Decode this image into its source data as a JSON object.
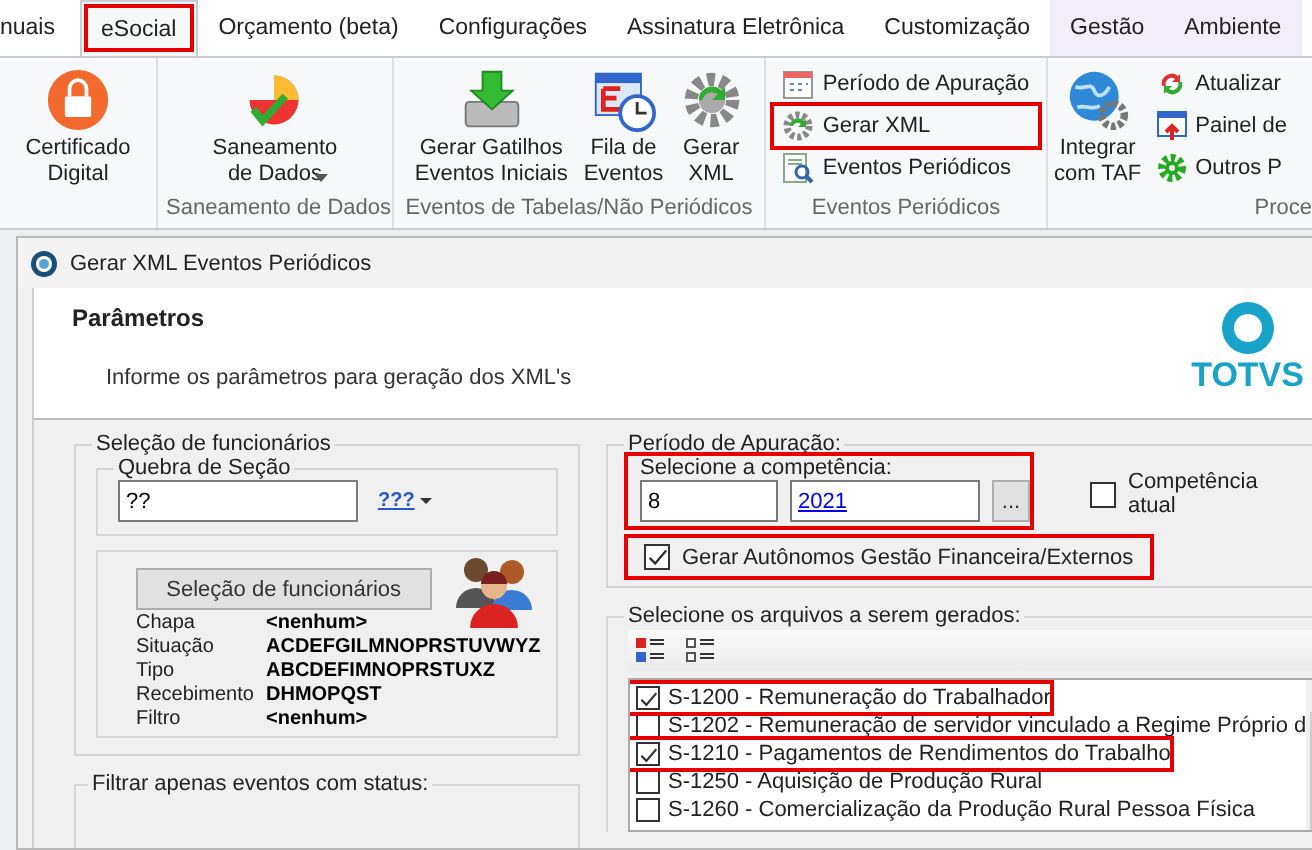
{
  "ribbon": {
    "tabs": [
      {
        "label": "nuais",
        "selected": false,
        "highlighted": false
      },
      {
        "label": "eSocial",
        "selected": true,
        "highlighted": true
      },
      {
        "label": "Orçamento (beta)",
        "selected": false,
        "highlighted": false
      },
      {
        "label": "Configurações",
        "selected": false,
        "highlighted": false
      },
      {
        "label": "Assinatura Eletrônica",
        "selected": false,
        "highlighted": false
      },
      {
        "label": "Customização",
        "selected": false,
        "highlighted": false
      },
      {
        "label": "Gestão",
        "selected": false,
        "highlighted": false
      },
      {
        "label": "Ambiente",
        "selected": false,
        "highlighted": false
      }
    ],
    "groups": [
      {
        "buttons": [
          {
            "kind": "large",
            "label": "Certificado\nDigital",
            "highlighted": false
          }
        ]
      },
      {
        "label": "Saneamento de Dados",
        "buttons": [
          {
            "kind": "dropdown",
            "label": "Saneamento\nde Dados",
            "highlighted": false
          }
        ]
      },
      {
        "label": "Eventos de Tabelas/Não Periódicos",
        "buttons": [
          {
            "kind": "large",
            "label": "Gerar Gatilhos\nEventos Iniciais",
            "highlighted": false
          },
          {
            "kind": "large",
            "label": "Fila de\nEventos",
            "highlighted": false
          },
          {
            "kind": "large",
            "label": "Gerar\nXML",
            "highlighted": false
          }
        ]
      },
      {
        "label": "Eventos Periódicos",
        "buttons": [
          {
            "kind": "small",
            "label": "Período de Apuração",
            "highlighted": false
          },
          {
            "kind": "small",
            "label": "Gerar XML",
            "highlighted": true
          },
          {
            "kind": "small",
            "label": "Eventos Periódicos",
            "highlighted": false
          }
        ]
      },
      {
        "label": "Proce",
        "buttons": [
          {
            "kind": "large",
            "label": "Integrar\ncom TAF",
            "highlighted": false
          },
          {
            "kind": "small",
            "label": "Atualizar",
            "highlighted": false
          },
          {
            "kind": "small",
            "label": "Painel de",
            "highlighted": false
          },
          {
            "kind": "small",
            "label": "Outros P",
            "highlighted": false
          }
        ]
      }
    ]
  },
  "dialog": {
    "title": "Gerar XML Eventos Periódicos",
    "header": {
      "title": "Parâmetros",
      "subtitle": "Informe os parâmetros para geração dos XML's",
      "logo": "TOTVS"
    },
    "employees": {
      "legend": "Seleção de funcionários",
      "section_break": {
        "legend": "Quebra de Seção",
        "value": "??",
        "picker": "???"
      },
      "select_button": "Seleção de funcionários",
      "info": [
        {
          "label": "Chapa",
          "value": "<nenhum>"
        },
        {
          "label": "Situação",
          "value": "ACDEFGILMNOPRSTUVWYZ"
        },
        {
          "label": "Tipo",
          "value": "ABCDEFIMNOPRSTUXZ"
        },
        {
          "label": "Recebimento",
          "value": "DHMOPQST"
        },
        {
          "label": "Filtro",
          "value": "<nenhum>"
        }
      ]
    },
    "status_filter": {
      "legend": "Filtrar apenas eventos com status:"
    },
    "period": {
      "legend": "Período de Apuração:",
      "competence": {
        "label": "Selecione a competência:",
        "month": "8",
        "year": "2021",
        "browse": "...",
        "highlighted": true
      },
      "current": {
        "label": "Competência atual",
        "checked": false
      },
      "autonomos": {
        "label": "Gerar Autônomos Gestão Financeira/Externos",
        "checked": true,
        "highlighted": true
      }
    },
    "files": {
      "legend": "Selecione os arquivos a serem gerados:",
      "items": [
        {
          "label": "S-1200 - Remuneração do Trabalhador",
          "checked": true,
          "highlighted": true
        },
        {
          "label": "S-1202 - Remuneração de servidor vinculado a Regime Próprio d",
          "checked": false,
          "highlighted": false
        },
        {
          "label": "S-1210 - Pagamentos de Rendimentos do Trabalho",
          "checked": true,
          "highlighted": true
        },
        {
          "label": "S-1250 - Aquisição de Produção Rural",
          "checked": false,
          "highlighted": false
        },
        {
          "label": "S-1260 - Comercialização da Produção Rural Pessoa Física",
          "checked": false,
          "highlighted": false
        }
      ]
    }
  }
}
